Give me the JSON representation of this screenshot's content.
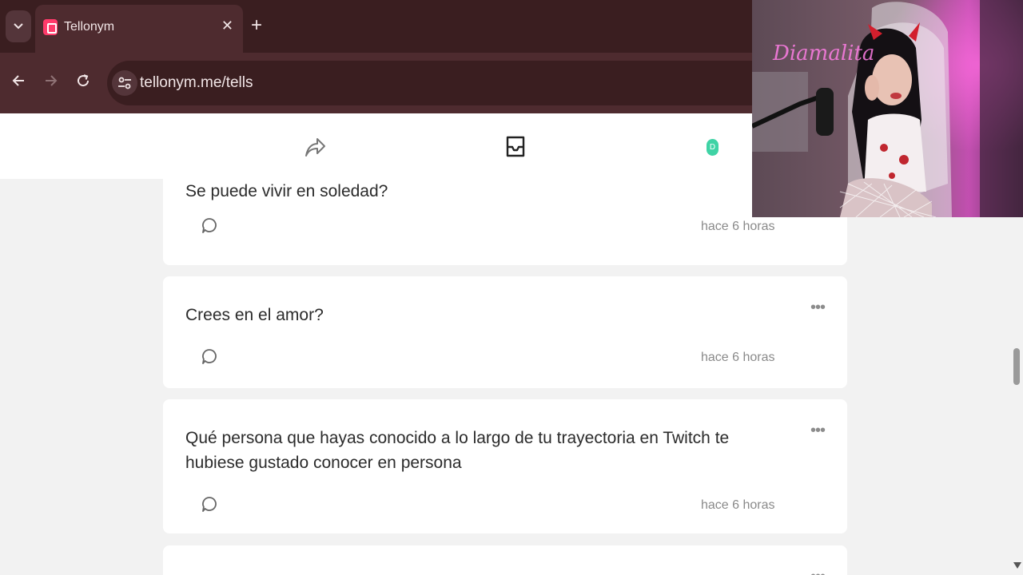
{
  "browser": {
    "tab_title": "Tellonym",
    "url": "tellonym.me/tells",
    "colors": {
      "frame": "#3a1e20",
      "toolbar": "#4e2b2f",
      "text": "#f2e6e7"
    }
  },
  "header": {
    "icons": [
      "share-icon",
      "inbox-icon"
    ],
    "avatar_letter": "D"
  },
  "tells": [
    {
      "question": "Se puede vivir en soledad?",
      "time": "hace 6 horas"
    },
    {
      "question": "Crees en el amor?",
      "time": "hace 6 horas"
    },
    {
      "question": "Qué persona que hayas conocido a lo largo de tu trayectoria en Twitch te hubiese gustado conocer en persona",
      "time": "hace 6 horas"
    }
  ],
  "overlay": {
    "sign_text": "Diamalita",
    "accent": "#ff4fd8"
  }
}
